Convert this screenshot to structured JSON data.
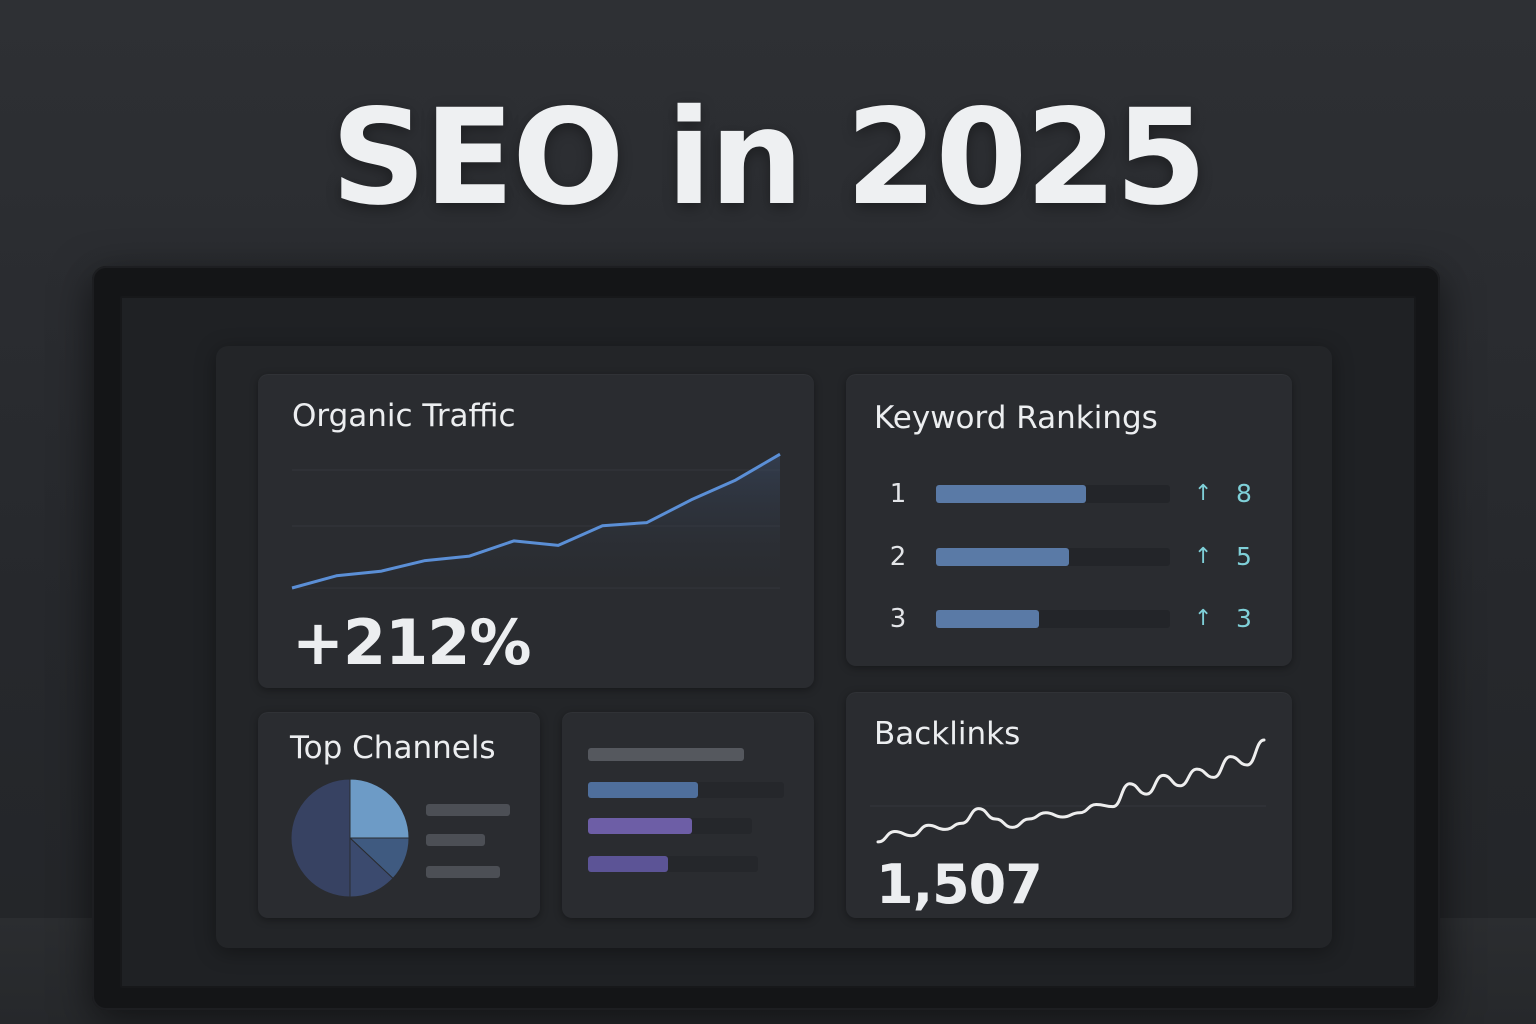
{
  "headline": "SEO in 2025",
  "colors": {
    "accent_blue": "#5b8fd6",
    "rank_bar": "#5a7aa6",
    "teal": "#7fd0d8",
    "purple": "#7364a8",
    "pie_slice_1": "#6d9bc6",
    "pie_slice_2": "#3f5a80",
    "pie_slice_3": "#3b4a6e",
    "pie_slice_4": "#374262",
    "backlinks_line": "#eeeeee"
  },
  "organic_traffic": {
    "title": "Organic Traffic",
    "value": "+212%",
    "chart_data": {
      "type": "area",
      "x": [
        0,
        1,
        2,
        3,
        4,
        5,
        6,
        7,
        8,
        9,
        10,
        11
      ],
      "values": [
        0,
        8,
        11,
        18,
        21,
        31,
        28,
        41,
        43,
        58,
        71,
        88
      ],
      "ylim": [
        0,
        100
      ],
      "grid": true
    }
  },
  "keyword_rankings": {
    "title": "Keyword Rankings",
    "arrow_icon": "arrow-up-icon",
    "rows": [
      {
        "position": "1",
        "change": "8",
        "bar_fill": 0.64
      },
      {
        "position": "2",
        "change": "5",
        "bar_fill": 0.57
      },
      {
        "position": "3",
        "change": "3",
        "bar_fill": 0.44
      }
    ]
  },
  "top_channels": {
    "title": "Top Channels",
    "chart_data": {
      "type": "pie",
      "values": [
        25,
        12,
        13,
        50
      ]
    },
    "legend_bar_fills": [
      1.0,
      0.7,
      0.88
    ]
  },
  "channel_bars": {
    "header_fill": 0.81,
    "chart_data": {
      "type": "bar",
      "orientation": "horizontal",
      "values": [
        0.56,
        0.53,
        0.41
      ],
      "colors": [
        "#4f6f9c",
        "#6d5ea6",
        "#5c5496"
      ]
    }
  },
  "backlinks": {
    "title": "Backlinks",
    "value": "1,507",
    "chart_data": {
      "type": "line",
      "x": [
        0,
        1,
        2,
        3,
        4,
        5,
        6,
        7,
        8,
        9,
        10,
        11,
        12,
        13,
        14,
        15,
        16,
        17,
        18,
        19,
        20,
        21,
        22,
        23
      ],
      "values": [
        2,
        12,
        8,
        18,
        14,
        20,
        34,
        24,
        16,
        24,
        30,
        26,
        30,
        38,
        36,
        58,
        48,
        66,
        56,
        72,
        64,
        84,
        76,
        100
      ],
      "ylim": [
        0,
        100
      ],
      "grid": true
    }
  }
}
